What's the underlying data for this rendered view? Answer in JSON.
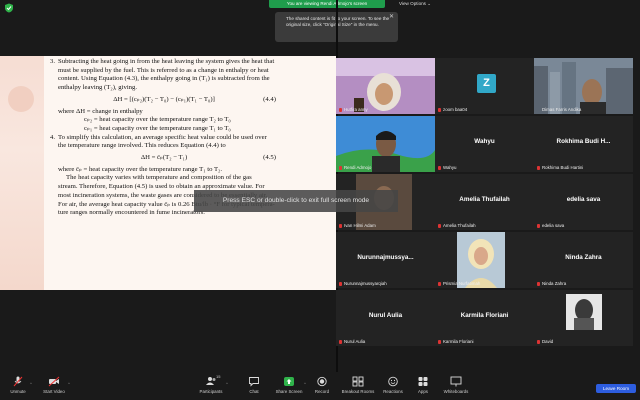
{
  "top_bar": {
    "share_banner": "You are viewing Rendi Admojo's screen",
    "view_options": "View Options ⌄",
    "tooltip_line1": "The shared content is fit to your screen. To see the",
    "tooltip_line2": "original size, click \"Original Size\" in the menu.",
    "tooltip_close": "✕"
  },
  "document": {
    "item3_num": "3.",
    "item3_lines": [
      "Subtracting the heat going in from the heat leaving the system gives the heat that",
      "must be supplied by the fuel. This is referred to as a change in enthalpy or heat",
      "content. Using Equation (4.3), the enthalpy going in (T₁) is subtracted from the",
      "enthalpy leaving (T₂), giving."
    ],
    "eq44": "ΔH = [(cₚ₂)(T₂ − T₀) − (cₚ₁)(T₁ − T₀)]",
    "eq44_num": "(4.4)",
    "where1": "where  ΔH = change in enthalpy",
    "where2": "cₚ₂ = heat capacity over the temperature range T₂ to T₀",
    "where3": "cₚ₁ = heat capacity over the temperature range T₁ to T₀",
    "item4_num": "4.",
    "item4_lines": [
      "To simplify this calculation, an average specific heat value could be used over",
      "the temperature range involved. This reduces Equation (4.4) to"
    ],
    "eq45": "ΔH = c̄ₚ(T₂ − T₁)",
    "eq45_num": "(4.5)",
    "where4": "where  c̄ₚ = heat capacity over the temperature range T₁ to T₂.",
    "para_lines": [
      "The heat capacity varies with temperature and composition of the gas",
      "stream. Therefore, Equation (4.5) is used to obtain an approximate value. For",
      "most incineration systems, the waste gases are considered to be essentially air.",
      "For air, the average heat capacity value c̄ₚ is 0.26 Btu/lb · °F for typical tempera-",
      "ture ranges normally encountered in fume incinerators."
    ]
  },
  "toast": "Press ESC or double-click to exit full screen mode",
  "participants_grid": [
    {
      "label": "Hutfira anny",
      "center_name": "",
      "kind": "photo"
    },
    {
      "label": "zoom baa04",
      "center_name": "",
      "kind": "avatar",
      "avatar_letter": "Z"
    },
    {
      "label": "Dimas Farris Andika",
      "center_name": "",
      "kind": "photo",
      "active": true
    },
    {
      "label": "Rendi Admojo",
      "center_name": "",
      "kind": "photo"
    },
    {
      "label": "Wahyu",
      "center_name": "Wahyu",
      "kind": "name"
    },
    {
      "label": "Rokhima Budi Hartini",
      "center_name": "Rokhima Budi H...",
      "kind": "name"
    },
    {
      "label": "Ivan Hilmi Adam",
      "center_name": "",
      "kind": "photo"
    },
    {
      "label": "Amelia Thufailah",
      "center_name": "Amelia Thufailah",
      "kind": "name"
    },
    {
      "label": "edelia sava",
      "center_name": "edelia sava",
      "kind": "name"
    },
    {
      "label": "Nurunnajmussyarqiah",
      "center_name": "Nurunnajmussya...",
      "kind": "name"
    },
    {
      "label": "Prismia Nurfatimah",
      "center_name": "",
      "kind": "photo"
    },
    {
      "label": "Ninda Zahra",
      "center_name": "Ninda Zahra",
      "kind": "name"
    },
    {
      "label": "Nurul Aulia",
      "center_name": "Nurul Aulia",
      "kind": "name"
    },
    {
      "label": "Karmila Floriani",
      "center_name": "Karmila Floriani",
      "kind": "name"
    },
    {
      "label": "David",
      "center_name": "",
      "kind": "photo"
    }
  ],
  "toolbar": {
    "unmute": "Unmute",
    "start_video": "Start Video",
    "participants": "Participants",
    "participants_count": "15",
    "chat": "Chat",
    "share_screen": "Share Screen",
    "record": "Record",
    "breakout_rooms": "Breakout Rooms",
    "reactions": "Reactions",
    "apps": "Apps",
    "whiteboards": "Whiteboards",
    "leave": "Leave Room"
  },
  "colors": {
    "share_banner": "#1f9d4c",
    "leave": "#2d5ddf",
    "active_speaker": "#c9d840",
    "muted_red": "#dd3333"
  }
}
